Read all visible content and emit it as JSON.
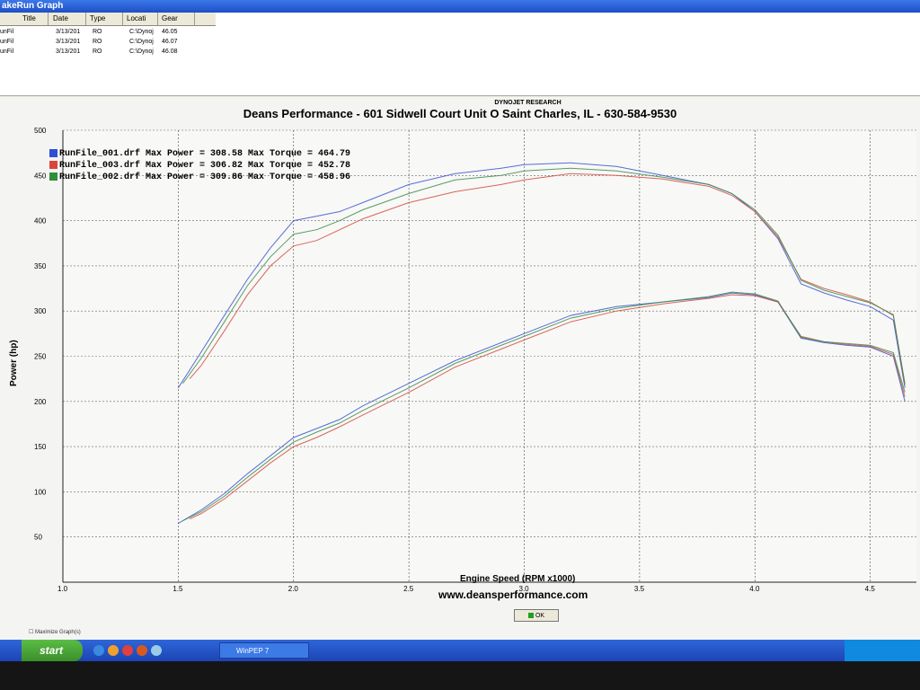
{
  "window": {
    "title": "akeRun Graph"
  },
  "file_list": {
    "columns": [
      "Title",
      "Date",
      "Type",
      "Locati",
      "Gear"
    ],
    "rows": [
      [
        "unFil",
        "3/13/201",
        "RO",
        "C:\\Dynoj",
        "46.05"
      ],
      [
        "unFil",
        "3/13/201",
        "RO",
        "C:\\Dynoj",
        "46.07"
      ],
      [
        "unFil",
        "3/13/201",
        "RO",
        "C:\\Dynoj",
        "46.08"
      ]
    ]
  },
  "header": {
    "dynojet": "DYNOJET RESEARCH",
    "title": "Deans Performance - 601 Sidwell Court Unit O Saint Charles, IL - 630-584-9530"
  },
  "legend": [
    {
      "text": "RunFile_001.drf Max Power = 308.58 Max Torque = 464.79",
      "color": "#2f4fd6"
    },
    {
      "text": "RunFile_003.drf Max Power = 306.82 Max Torque = 452.78",
      "color": "#d9453a"
    },
    {
      "text": "RunFile_002.drf Max Power = 309.86 Max Torque = 458.96",
      "color": "#2f8f3a"
    }
  ],
  "footer": {
    "website": "www.deansperformance.com",
    "ok_label": "OK",
    "maximize_label": "Maximize Graph(s)"
  },
  "taskbar": {
    "start_label": "start",
    "task_item": "WinPEP 7"
  },
  "chart_data": {
    "type": "line",
    "xlabel": "Engine Speed (RPM x1000)",
    "ylabel": "Power (hp)",
    "xlim": [
      1.0,
      4.7
    ],
    "ylim": [
      0,
      500
    ],
    "x_ticks": [
      "1.0",
      "1.5",
      "2.0",
      "2.5",
      "3.0",
      "3.5",
      "4.0",
      "4.5"
    ],
    "y_ticks": [
      "50",
      "100",
      "150",
      "200",
      "250",
      "300",
      "350",
      "400",
      "450",
      "500"
    ],
    "grid": true,
    "legend_position": "top-left",
    "series": [
      {
        "name": "RunFile_001.drf",
        "color": "#3a55d0",
        "power": {
          "x": [
            1.5,
            1.6,
            1.7,
            1.8,
            1.9,
            2.0,
            2.1,
            2.2,
            2.3,
            2.5,
            2.7,
            2.9,
            3.0,
            3.2,
            3.4,
            3.6,
            3.8,
            3.9,
            4.0,
            4.1,
            4.2,
            4.3,
            4.4,
            4.5,
            4.6,
            4.65
          ],
          "y": [
            65,
            80,
            98,
            120,
            140,
            160,
            170,
            180,
            195,
            220,
            245,
            265,
            275,
            295,
            305,
            310,
            315,
            320,
            318,
            310,
            270,
            265,
            262,
            260,
            250,
            200
          ]
        },
        "torque": {
          "x": [
            1.5,
            1.6,
            1.7,
            1.8,
            1.9,
            2.0,
            2.1,
            2.2,
            2.3,
            2.5,
            2.7,
            2.9,
            3.0,
            3.2,
            3.4,
            3.6,
            3.8,
            3.9,
            4.0,
            4.1,
            4.2,
            4.3,
            4.4,
            4.5,
            4.6,
            4.65
          ],
          "y": [
            215,
            255,
            295,
            335,
            370,
            400,
            405,
            410,
            420,
            440,
            452,
            458,
            462,
            464,
            460,
            450,
            440,
            430,
            410,
            380,
            330,
            320,
            312,
            305,
            290,
            215
          ]
        }
      },
      {
        "name": "RunFile_003.drf",
        "color": "#d24a3e",
        "power": {
          "x": [
            1.55,
            1.6,
            1.7,
            1.8,
            1.9,
            2.0,
            2.1,
            2.2,
            2.3,
            2.5,
            2.7,
            2.9,
            3.0,
            3.2,
            3.4,
            3.6,
            3.8,
            3.9,
            4.0,
            4.1,
            4.2,
            4.3,
            4.4,
            4.5,
            4.6,
            4.65
          ],
          "y": [
            70,
            76,
            92,
            112,
            132,
            150,
            160,
            172,
            185,
            210,
            238,
            258,
            268,
            288,
            300,
            308,
            314,
            318,
            317,
            310,
            272,
            266,
            263,
            261,
            252,
            205
          ]
        },
        "torque": {
          "x": [
            1.55,
            1.6,
            1.7,
            1.8,
            1.9,
            2.0,
            2.1,
            2.2,
            2.3,
            2.5,
            2.7,
            2.9,
            3.0,
            3.2,
            3.4,
            3.6,
            3.8,
            3.9,
            4.0,
            4.1,
            4.2,
            4.3,
            4.4,
            4.5,
            4.6,
            4.65
          ],
          "y": [
            225,
            240,
            278,
            318,
            350,
            372,
            378,
            390,
            402,
            420,
            432,
            440,
            445,
            452,
            450,
            446,
            438,
            428,
            410,
            382,
            335,
            325,
            318,
            310,
            295,
            220
          ]
        }
      },
      {
        "name": "RunFile_002.drf",
        "color": "#3b8c4a",
        "power": {
          "x": [
            1.52,
            1.6,
            1.7,
            1.8,
            1.9,
            2.0,
            2.1,
            2.2,
            2.3,
            2.5,
            2.7,
            2.9,
            3.0,
            3.2,
            3.4,
            3.6,
            3.8,
            3.9,
            4.0,
            4.1,
            4.2,
            4.3,
            4.4,
            4.5,
            4.6,
            4.65
          ],
          "y": [
            68,
            78,
            95,
            116,
            136,
            155,
            166,
            176,
            190,
            215,
            242,
            262,
            272,
            292,
            303,
            310,
            316,
            321,
            319,
            311,
            271,
            266,
            264,
            262,
            254,
            210
          ]
        },
        "torque": {
          "x": [
            1.52,
            1.6,
            1.7,
            1.8,
            1.9,
            2.0,
            2.1,
            2.2,
            2.3,
            2.5,
            2.7,
            2.9,
            3.0,
            3.2,
            3.4,
            3.6,
            3.8,
            3.9,
            4.0,
            4.1,
            4.2,
            4.3,
            4.4,
            4.5,
            4.6,
            4.65
          ],
          "y": [
            220,
            248,
            288,
            328,
            360,
            385,
            390,
            400,
            412,
            430,
            445,
            450,
            455,
            458,
            455,
            448,
            440,
            430,
            412,
            384,
            334,
            323,
            316,
            309,
            296,
            218
          ]
        }
      }
    ]
  }
}
